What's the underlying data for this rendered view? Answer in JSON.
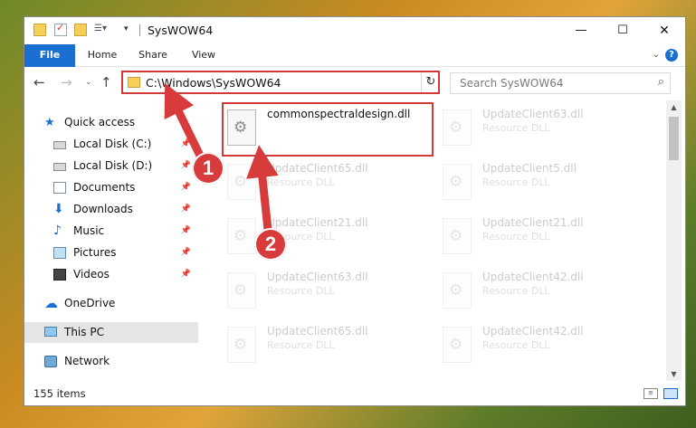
{
  "window": {
    "title": "SysWOW64",
    "controls": {
      "minimize": "—",
      "maximize": "☐",
      "close": "✕"
    }
  },
  "ribbon": {
    "tabs": [
      {
        "label": "File"
      },
      {
        "label": "Home"
      },
      {
        "label": "Share"
      },
      {
        "label": "View"
      }
    ],
    "help": "?"
  },
  "navigation": {
    "address": "C:\\Windows\\SysWOW64",
    "search_placeholder": "Search SysWOW64"
  },
  "sidebar": {
    "items": [
      {
        "label": "Quick access",
        "icon": "star-icon"
      },
      {
        "label": "Local Disk (C:)",
        "icon": "drive-icon",
        "pinned": true
      },
      {
        "label": "Local Disk (D:)",
        "icon": "drive-icon",
        "pinned": true
      },
      {
        "label": "Documents",
        "icon": "document-icon",
        "pinned": true
      },
      {
        "label": "Downloads",
        "icon": "download-icon",
        "pinned": true
      },
      {
        "label": "Music",
        "icon": "music-icon",
        "pinned": true
      },
      {
        "label": "Pictures",
        "icon": "pictures-icon",
        "pinned": true
      },
      {
        "label": "Videos",
        "icon": "video-icon",
        "pinned": true
      },
      {
        "label": "OneDrive",
        "icon": "cloud-icon"
      },
      {
        "label": "This PC",
        "icon": "computer-icon",
        "selected": true
      },
      {
        "label": "Network",
        "icon": "network-icon"
      }
    ]
  },
  "files": [
    {
      "name": "commonspectraldesign.dll",
      "type": "",
      "highlighted": true
    },
    {
      "name": "UpdateClient63.dll",
      "type": "Resource DLL"
    },
    {
      "name": "UpdateClient65.dll",
      "type": "Resource DLL"
    },
    {
      "name": "UpdateClient5.dll",
      "type": "Resource DLL"
    },
    {
      "name": "UpdateClient21.dll",
      "type": "Resource DLL"
    },
    {
      "name": "UpdateClient21.dll",
      "type": "Resource DLL"
    },
    {
      "name": "UpdateClient63.dll",
      "type": "Resource DLL"
    },
    {
      "name": "UpdateClient42.dll",
      "type": "Resource DLL"
    },
    {
      "name": "UpdateClient65.dll",
      "type": "Resource DLL"
    },
    {
      "name": "UpdateClient42.dll",
      "type": "Resource DLL"
    }
  ],
  "status": {
    "item_count": "155 items"
  },
  "annotations": {
    "step1": "1",
    "step2": "2",
    "color": "#d73b3b"
  },
  "colors": {
    "accent": "#1a6fd1",
    "highlight": "#d23a3a"
  }
}
